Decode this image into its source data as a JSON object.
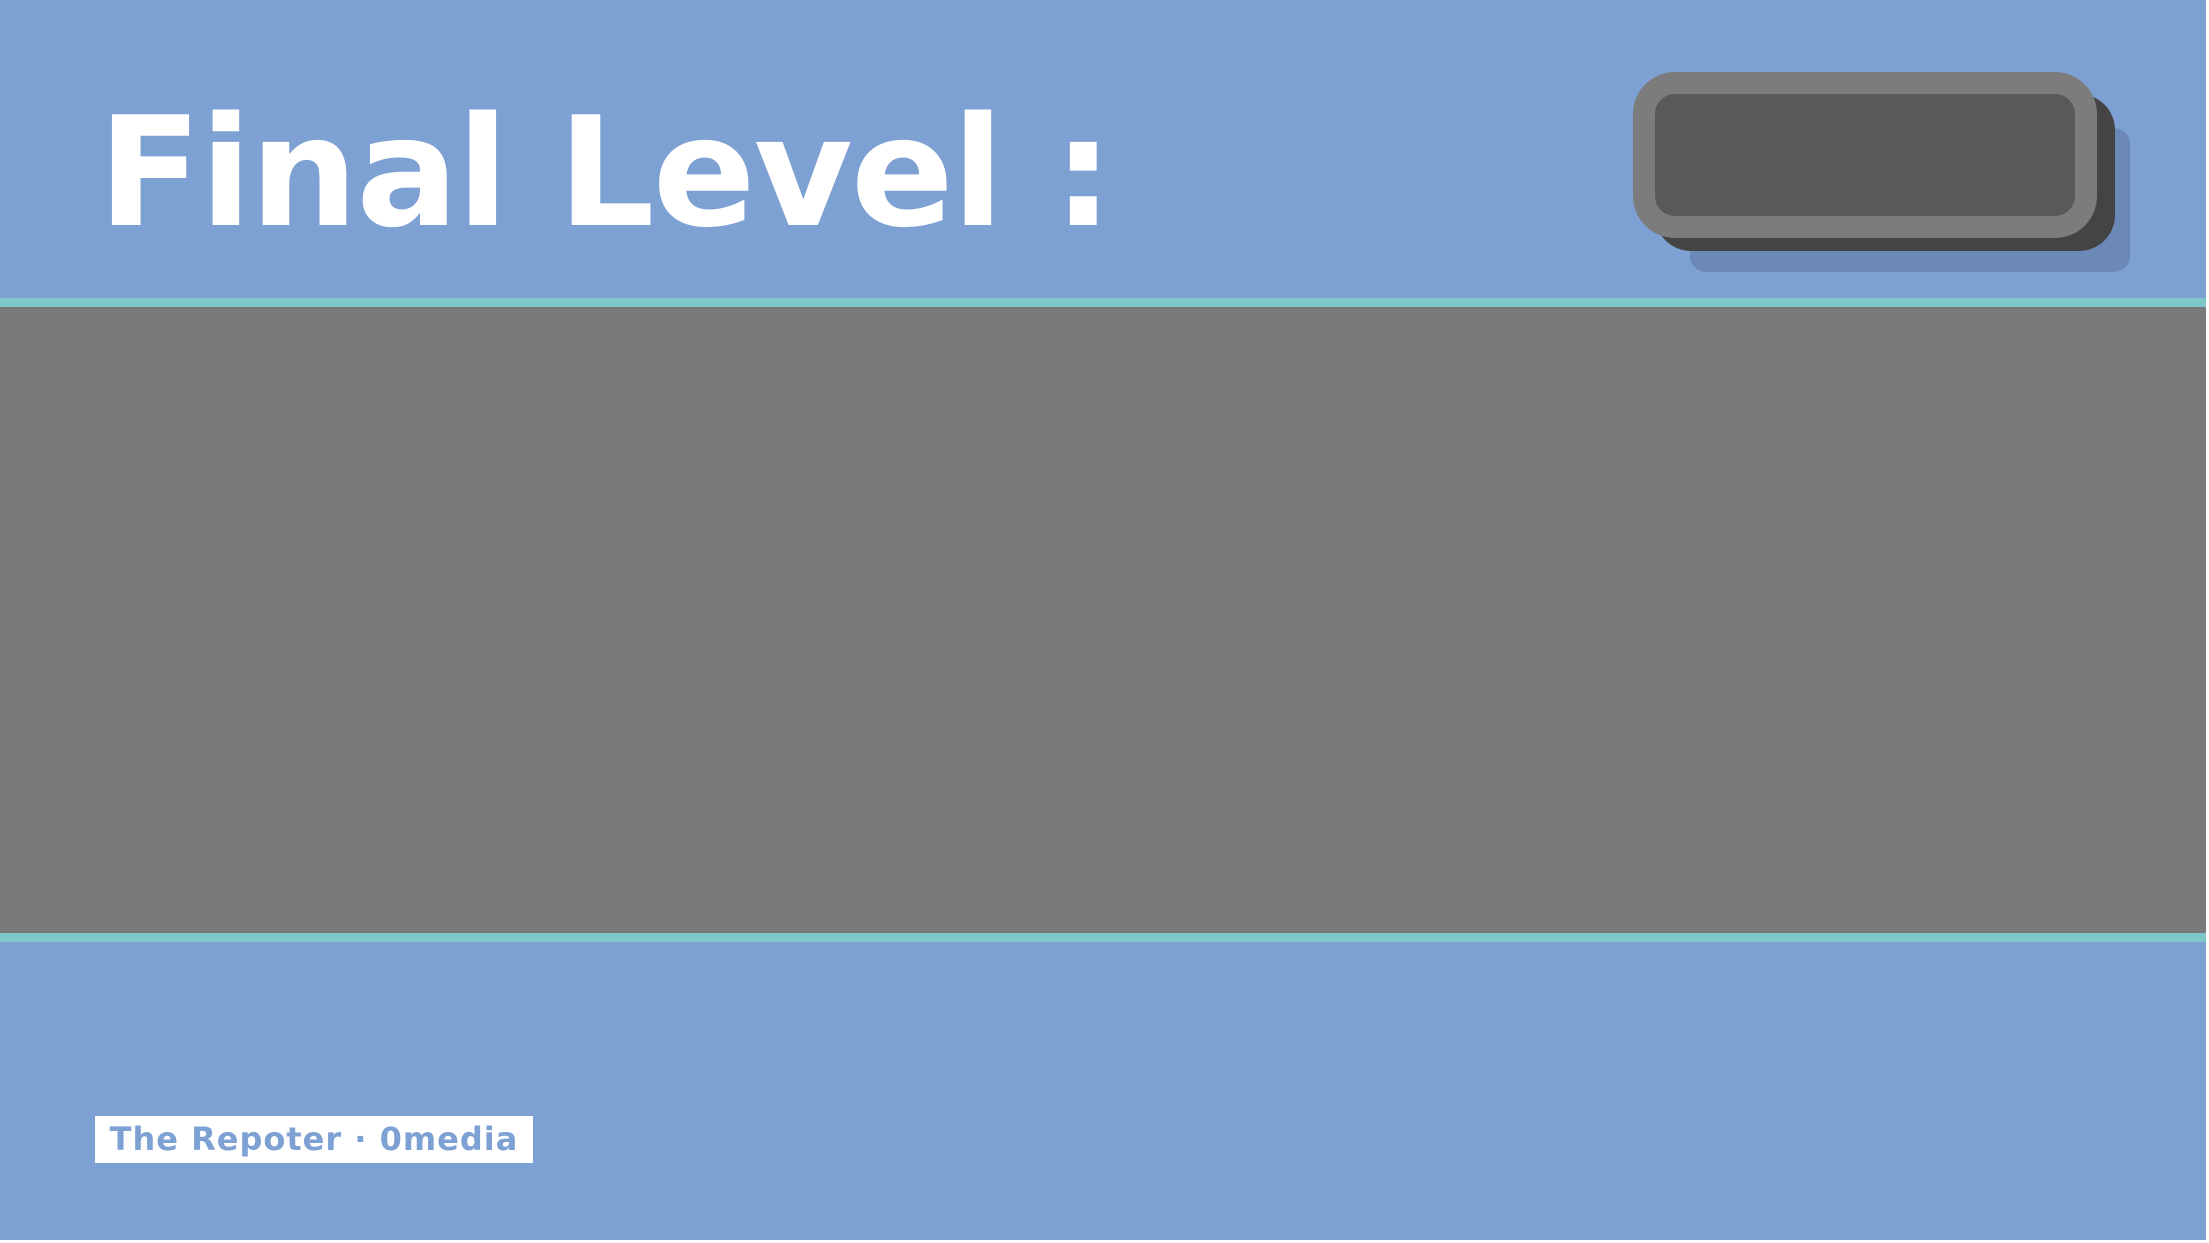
{
  "header": {
    "title": "Final Level :",
    "level_value": ""
  },
  "footer": {
    "credit": "The Repoter · 0media"
  },
  "colors": {
    "background": "#7ea1d4",
    "accent_line": "#7ec8cc",
    "content_band": "#7a7a7a",
    "box_fill": "#58595b",
    "box_border": "#7c7c7c",
    "title_text": "#ffffff"
  }
}
